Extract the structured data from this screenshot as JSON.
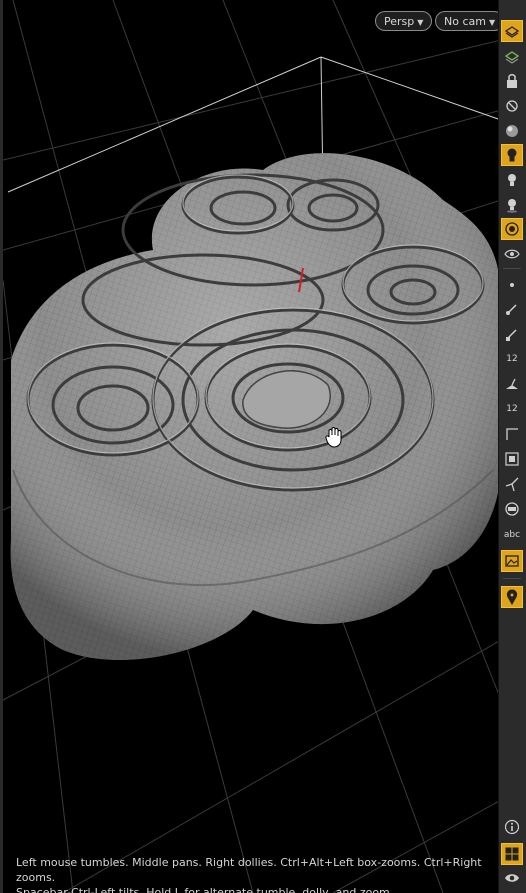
{
  "viewport": {
    "camera_mode_label": "Persp",
    "camera_label": "No cam"
  },
  "status": {
    "line1": "Left mouse tumbles. Middle pans. Right dollies. Ctrl+Alt+Left box-zooms. Ctrl+Right zooms.",
    "line2": "Spacebar-Ctrl-Left tilts. Hold L for alternate tumble, dolly, and zoom."
  },
  "toolbar": {
    "text_label": "abc",
    "point_numbers_label": "12",
    "prim_numbers_label": "12",
    "accent_color": "#e0a419",
    "items": [
      {
        "name": "display-options-icon",
        "active": true
      },
      {
        "name": "ghost-other-objects-icon",
        "active": false
      },
      {
        "name": "lock-camera-icon",
        "active": false
      },
      {
        "name": "hide-other-objects-icon",
        "active": false
      },
      {
        "name": "shading-mode-icon",
        "active": false
      },
      {
        "name": "headlight-icon",
        "active": true
      },
      {
        "name": "lights-icon",
        "active": false
      },
      {
        "name": "lights-shadows-icon",
        "active": false
      },
      {
        "name": "background-image-icon",
        "active": true
      },
      {
        "name": "visualizers-icon",
        "active": false
      },
      {
        "name": "display-points-icon",
        "active": false
      },
      {
        "name": "point-normals-icon",
        "active": false
      },
      {
        "name": "prim-normals-icon",
        "active": false
      },
      {
        "name": "point-numbers-icon",
        "active": false
      },
      {
        "name": "vertex-normals-icon",
        "active": false
      },
      {
        "name": "prim-numbers-icon",
        "active": false
      },
      {
        "name": "uv-display-icon",
        "active": false
      },
      {
        "name": "snapping-icon",
        "active": false
      },
      {
        "name": "handles-icon",
        "active": false
      },
      {
        "name": "transparency-icon",
        "active": false
      },
      {
        "name": "text-annotations-icon",
        "active": false
      },
      {
        "name": "image-overlay-icon",
        "active": true
      },
      {
        "name": "pin-viewpoint-icon",
        "active": true
      },
      {
        "name": "info-icon",
        "active": false
      },
      {
        "name": "viewport-layout-icon",
        "active": true
      },
      {
        "name": "visibility-eye-icon",
        "active": false
      }
    ]
  }
}
